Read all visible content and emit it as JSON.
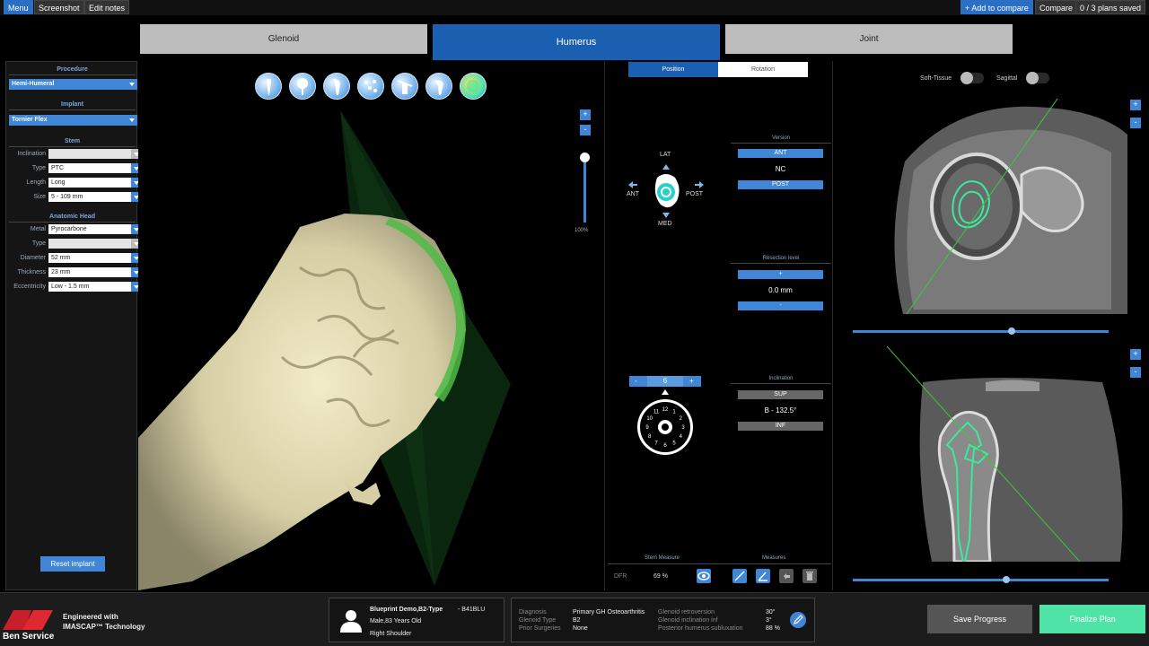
{
  "topbar": {
    "menu": "Menu",
    "screenshot": "Screenshot",
    "edit_notes": "Edit notes",
    "add_compare": "+ Add to compare",
    "compare": "Compare",
    "plans_saved": "0 / 3 plans saved"
  },
  "tabs": [
    "Glenoid",
    "Humerus",
    "Joint"
  ],
  "left": {
    "procedure_title": "Procedure",
    "procedure_value": "Hemi-Humeral",
    "implant_title": "Implant",
    "implant_value": "Tornier Flex",
    "stem_title": "Stem",
    "stem_rows": [
      {
        "label": "Inclination",
        "value": ""
      },
      {
        "label": "Type",
        "value": "PTC"
      },
      {
        "label": "Length",
        "value": "Long"
      },
      {
        "label": "Size",
        "value": "5 - 109 mm"
      }
    ],
    "head_title": "Anatomic Head",
    "head_rows": [
      {
        "label": "Metal",
        "value": "Pyrocarbone"
      },
      {
        "label": "Type",
        "value": ""
      },
      {
        "label": "Diameter",
        "value": "52 mm"
      },
      {
        "label": "Thickness",
        "value": "23 mm"
      },
      {
        "label": "Eccentricity",
        "value": "Low - 1.5 mm"
      }
    ],
    "reset": "Reset implant"
  },
  "viewport": {
    "zoom_plus": "+",
    "zoom_minus": "-",
    "zoom_level": "100%"
  },
  "middle": {
    "subtab_position": "Position",
    "subtab_rotation": "Rotation",
    "dirs": {
      "lat": "LAT",
      "ant": "ANT",
      "post": "POST",
      "med": "MED"
    },
    "version_title": "Version",
    "version_up": "ANT",
    "version_value": "NC",
    "version_down": "POST",
    "resection_title": "Resection level",
    "resection_up": "+",
    "resection_value": "0.0 mm",
    "resection_down": "-",
    "inclination_title": "Inclination",
    "inclination_up": "SUP",
    "inclination_value": "B - 132.5°",
    "inclination_down": "INF",
    "stepper_minus": "-",
    "stepper_value": "6",
    "stepper_plus": "+",
    "dial_numbers": [
      "12",
      "1",
      "2",
      "3",
      "4",
      "5",
      "6",
      "7",
      "8",
      "9",
      "10",
      "11"
    ],
    "stem_measure": "Stem Measure",
    "measures": "Measures",
    "dfr_label": "DFR",
    "dfr_value": "69 %"
  },
  "right": {
    "soft_tissue": "Soft-Tissue",
    "sagittal": "Sagittal",
    "plus": "+",
    "minus": "-",
    "slider1": 0.62,
    "slider2": 0.6
  },
  "footer": {
    "brand_user": "Ben Service",
    "engineered_1": "Engineered with",
    "engineered_2": "IMASCAP™ Technology",
    "patient_name": "Blueprint Demo,B2-Type",
    "patient_id": "- B41BLU",
    "patient_info": "Male,83 Years Old",
    "patient_side": "Right Shoulder",
    "diag_rows": [
      {
        "label": "Diagnosis",
        "value": "Primary GH Osteoarthritis"
      },
      {
        "label": "Glenoid Type",
        "value": "B2"
      },
      {
        "label": "Prior Surgeries",
        "value": "None"
      }
    ],
    "measure_rows": [
      {
        "label": "Glenoid retroversion",
        "value": "30°"
      },
      {
        "label": "Glenoid inclination inf",
        "value": "3°"
      },
      {
        "label": "Posterior humerus subluxation",
        "value": "88 %"
      }
    ],
    "save": "Save Progress",
    "finalize": "Finalize Plan"
  },
  "colors": {
    "accent": "#3f86d6",
    "tab_active": "#1b5fb0",
    "finalize": "#4fe3a8",
    "implant_green": "#3de8a0"
  }
}
